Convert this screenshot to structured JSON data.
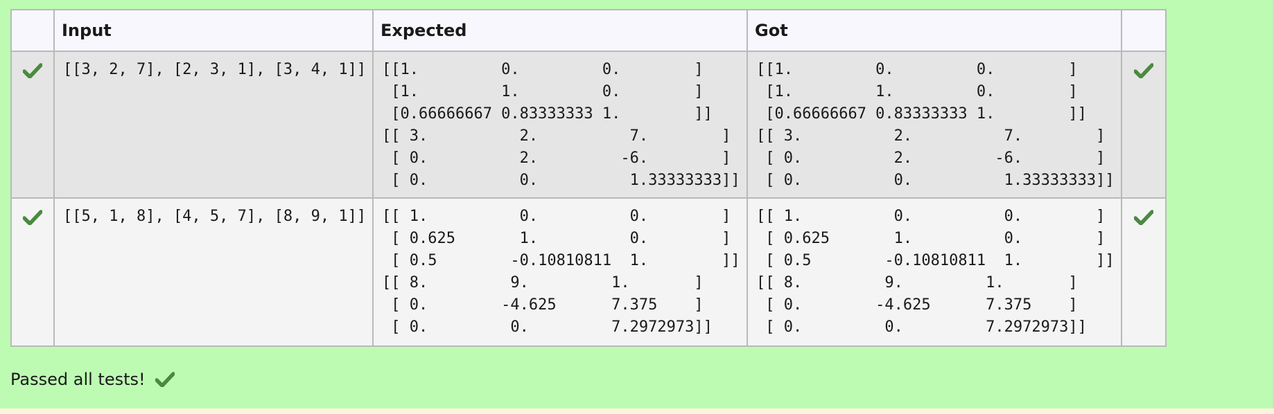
{
  "table": {
    "headers": {
      "input": "Input",
      "expected": "Expected",
      "got": "Got"
    },
    "rows": [
      {
        "status": "passed",
        "input": "[[3, 2, 7], [2, 3, 1], [3, 4, 1]]",
        "expected": "[[1.         0.         0.        ]\n [1.         1.         0.        ]\n [0.66666667 0.83333333 1.        ]]\n[[ 3.          2.          7.        ]\n [ 0.          2.         -6.        ]\n [ 0.          0.          1.33333333]]",
        "got": "[[1.         0.         0.        ]\n [1.         1.         0.        ]\n [0.66666667 0.83333333 1.        ]]\n[[ 3.          2.          7.        ]\n [ 0.          2.         -6.        ]\n [ 0.          0.          1.33333333]]"
      },
      {
        "status": "passed",
        "input": "[[5, 1, 8], [4, 5, 7], [8, 9, 1]]",
        "expected": "[[ 1.          0.          0.        ]\n [ 0.625       1.          0.        ]\n [ 0.5        -0.10810811  1.        ]]\n[[ 8.         9.         1.       ]\n [ 0.        -4.625      7.375    ]\n [ 0.         0.         7.2972973]]",
        "got": "[[ 1.          0.          0.        ]\n [ 0.625       1.          0.        ]\n [ 0.5        -0.10810811  1.        ]]\n[[ 8.         9.         1.       ]\n [ 0.        -4.625      7.375    ]\n [ 0.         0.         7.2972973]]"
      }
    ]
  },
  "summary": {
    "text": "Passed all tests!"
  },
  "icons": {
    "check": "check-icon"
  },
  "colors": {
    "panel_background": "#bdfbb3",
    "check": "#4a8a3f",
    "header_background": "#f7f7fd",
    "row_odd": "#e5e5e5",
    "row_even": "#f4f4f4",
    "border": "#b9b9b9"
  }
}
